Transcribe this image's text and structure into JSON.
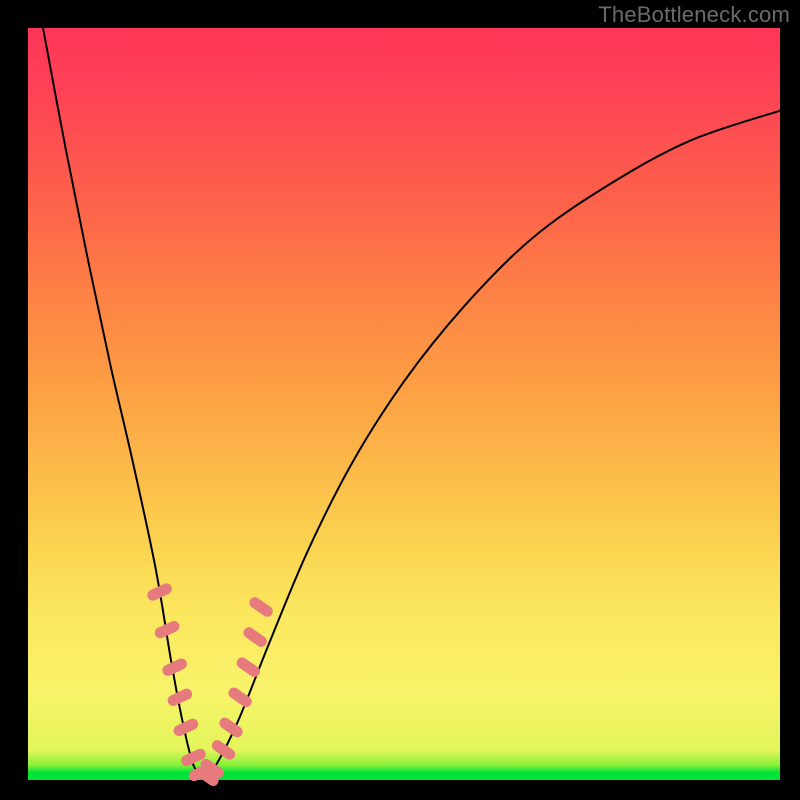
{
  "watermark": "TheBottleneck.com",
  "colors": {
    "background": "#000000",
    "gradient_top": "#ff3558",
    "gradient_bottom": "#00e43a",
    "curve": "#000000",
    "marker": "#e77a7d"
  },
  "chart_data": {
    "type": "line",
    "title": "",
    "xlabel": "",
    "ylabel": "",
    "xlim": [
      0,
      100
    ],
    "ylim": [
      0,
      100
    ],
    "grid": false,
    "legend": false,
    "note": "V-shaped bottleneck curve. x is component ratio (arbitrary %), y is bottleneck severity (%). Values estimated from pixel positions; no axis ticks present in source image.",
    "series": [
      {
        "name": "bottleneck-curve",
        "x": [
          2,
          5,
          8,
          11,
          14,
          17,
          19,
          20.5,
          22,
          23.5,
          25,
          28,
          32,
          37,
          43,
          50,
          58,
          67,
          77,
          88,
          100
        ],
        "y": [
          100,
          84,
          69,
          55,
          42,
          28,
          16,
          8,
          2,
          0.5,
          2,
          8,
          18,
          30,
          42,
          53,
          63,
          72,
          79,
          85,
          89
        ]
      }
    ],
    "markers": {
      "name": "highlighted-range",
      "shape": "rounded-rect",
      "color": "#e77a7d",
      "points_x": [
        17.5,
        18.5,
        19.5,
        20.2,
        21.0,
        22.0,
        23.0,
        23.8,
        24.5,
        26.0,
        27.0,
        28.2,
        29.3,
        30.2,
        31.0
      ],
      "points_y": [
        25,
        20,
        15,
        11,
        7,
        3,
        1,
        0.5,
        1.5,
        4,
        7,
        11,
        15,
        19,
        23
      ]
    }
  }
}
